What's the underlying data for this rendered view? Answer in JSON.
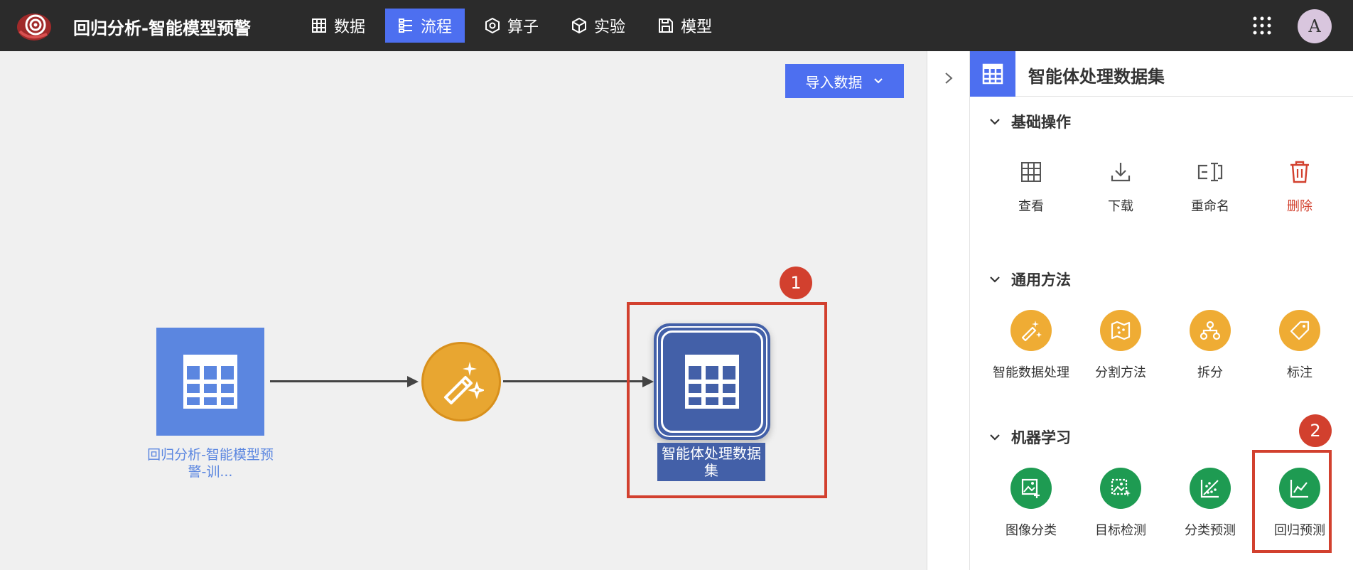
{
  "app": {
    "title": "回归分析-智能模型预警",
    "avatar_letter": "A",
    "nav": [
      {
        "label": "数据",
        "icon": "table-icon",
        "active": false
      },
      {
        "label": "流程",
        "icon": "flow-icon",
        "active": true
      },
      {
        "label": "算子",
        "icon": "hexagon-icon",
        "active": false
      },
      {
        "label": "实验",
        "icon": "cube-icon",
        "active": false
      },
      {
        "label": "模型",
        "icon": "save-icon",
        "active": false
      }
    ]
  },
  "canvas": {
    "import_button_label": "导入数据",
    "nodes": {
      "source_label": "回归分析-智能模型预警-训...",
      "output_label": "智能体处理数据集"
    },
    "annotations": [
      "1",
      "2"
    ]
  },
  "panel": {
    "title": "智能体处理数据集",
    "sections": {
      "basic": {
        "title": "基础操作",
        "actions": [
          {
            "label": "查看",
            "icon": "table-icon"
          },
          {
            "label": "下载",
            "icon": "download-icon"
          },
          {
            "label": "重命名",
            "icon": "rename-icon"
          },
          {
            "label": "删除",
            "icon": "trash-icon",
            "color": "#d2402e"
          }
        ]
      },
      "general": {
        "title": "通用方法",
        "tools": [
          {
            "label": "智能数据处理",
            "icon": "magic-wand-icon"
          },
          {
            "label": "分割方法",
            "icon": "map-split-icon"
          },
          {
            "label": "拆分",
            "icon": "hierarchy-icon"
          },
          {
            "label": "标注",
            "icon": "tag-icon"
          }
        ]
      },
      "ml": {
        "title": "机器学习",
        "tools": [
          {
            "label": "图像分类",
            "icon": "image-classify-icon"
          },
          {
            "label": "目标检测",
            "icon": "object-detect-icon"
          },
          {
            "label": "分类预测",
            "icon": "scatter-icon"
          },
          {
            "label": "回归预测",
            "icon": "line-chart-icon"
          }
        ]
      }
    }
  },
  "colors": {
    "accent": "#4d6ff0",
    "topbar": "#2b2b2b",
    "highlight": "#d2402e",
    "orange": "#efac34",
    "green": "#1e9b52",
    "node_dark": "#4360a8",
    "node_light": "#5b86e0"
  }
}
